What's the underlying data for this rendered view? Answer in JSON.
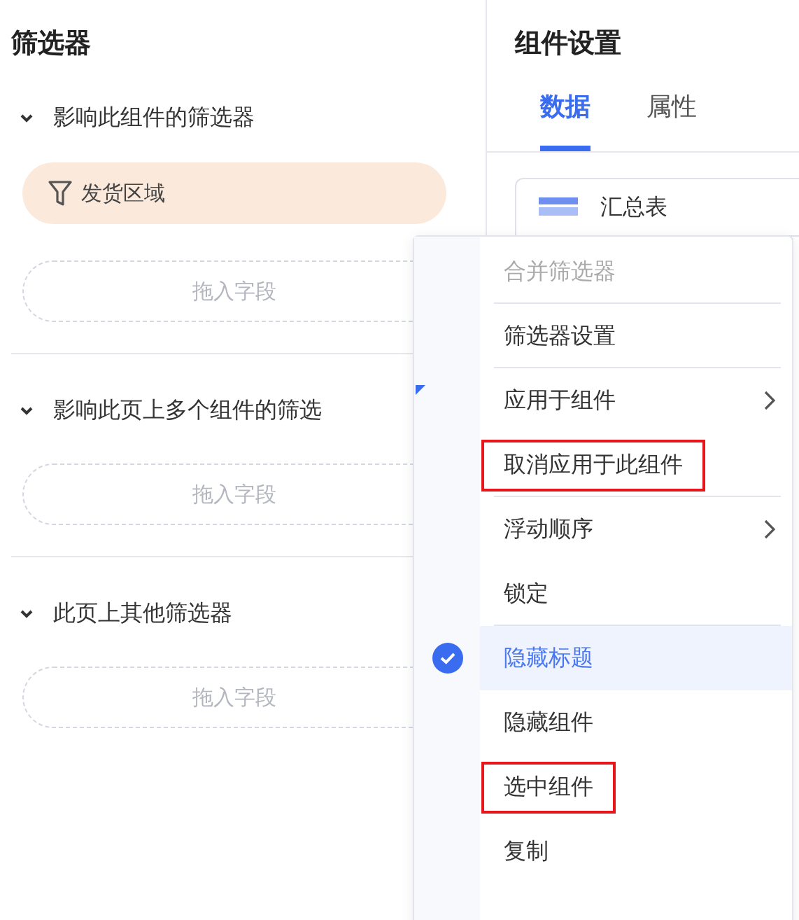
{
  "filters_panel": {
    "title": "筛选器",
    "sections": [
      {
        "title": "影响此组件的筛选器",
        "expanded": true,
        "chips": [
          "发货区域"
        ],
        "dropzone": "拖入字段"
      },
      {
        "title": "影响此页上多个组件的筛选",
        "expanded": true,
        "dropzone": "拖入字段"
      },
      {
        "title": "此页上其他筛选器",
        "expanded": true,
        "dropzone": "拖入字段"
      }
    ]
  },
  "settings_panel": {
    "title": "组件设置",
    "tabs": [
      {
        "label": "数据",
        "selected": true
      },
      {
        "label": "属性",
        "selected": false
      }
    ],
    "component": "汇总表"
  },
  "context_menu": {
    "items": [
      {
        "label": "合并筛选器",
        "disabled": true,
        "submenu": false,
        "checked": false,
        "highlighted": false,
        "separator_after": true
      },
      {
        "label": "筛选器设置",
        "disabled": false,
        "submenu": false,
        "checked": false,
        "highlighted": false,
        "separator_after": true
      },
      {
        "label": "应用于组件",
        "disabled": false,
        "submenu": true,
        "checked": false,
        "highlighted": false,
        "separator_after": false
      },
      {
        "label": "取消应用于此组件",
        "disabled": false,
        "submenu": false,
        "checked": false,
        "highlighted": true,
        "separator_after": true
      },
      {
        "label": "浮动顺序",
        "disabled": false,
        "submenu": true,
        "checked": false,
        "highlighted": false,
        "separator_after": false
      },
      {
        "label": "锁定",
        "disabled": false,
        "submenu": false,
        "checked": false,
        "highlighted": false,
        "separator_after": true
      },
      {
        "label": "隐藏标题",
        "disabled": false,
        "submenu": false,
        "checked": true,
        "highlighted": false,
        "separator_after": false
      },
      {
        "label": "隐藏组件",
        "disabled": false,
        "submenu": false,
        "checked": false,
        "highlighted": false,
        "separator_after": false
      },
      {
        "label": "选中组件",
        "disabled": false,
        "submenu": false,
        "checked": false,
        "highlighted": true,
        "separator_after": false
      },
      {
        "label": "复制",
        "disabled": false,
        "submenu": false,
        "checked": false,
        "highlighted": false,
        "separator_after": false
      }
    ]
  }
}
